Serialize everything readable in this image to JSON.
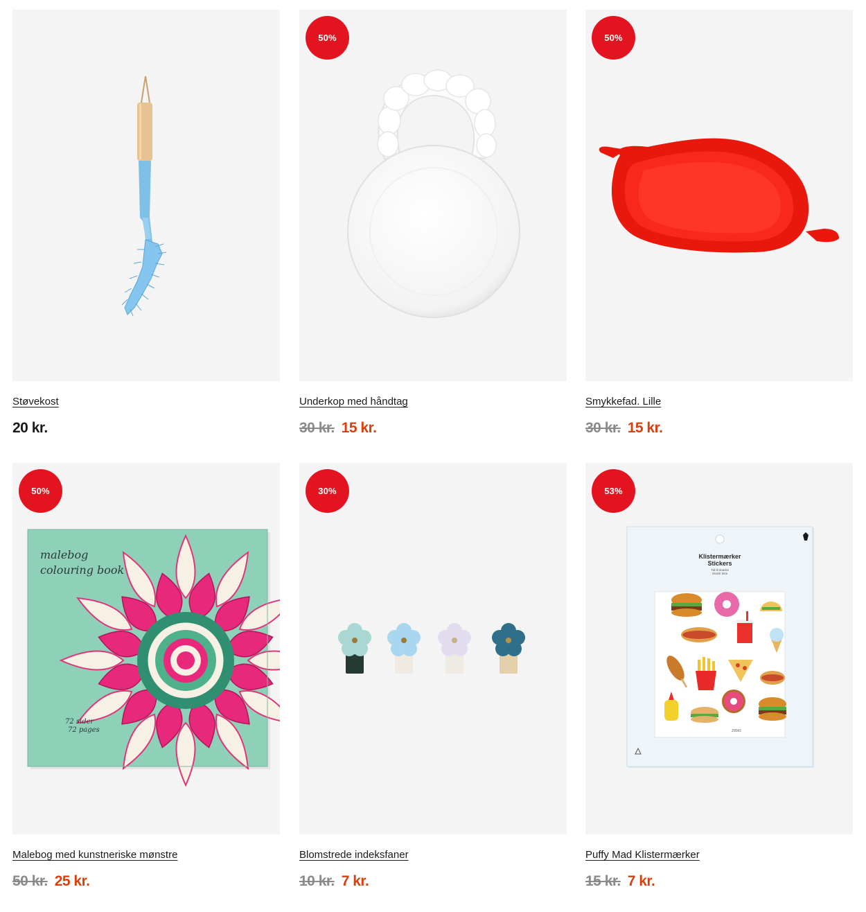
{
  "products": [
    {
      "name": "Støvekost",
      "price": "20 kr.",
      "image": "duster-icon"
    },
    {
      "name": "Underkop med håndtag",
      "badge": "50%",
      "old_price": "30 kr.",
      "price": "15 kr.",
      "image": "saucer-icon"
    },
    {
      "name": "Smykkefad. Lille",
      "badge": "50%",
      "old_price": "30 kr.",
      "price": "15 kr.",
      "image": "heart-tray-icon"
    },
    {
      "name": "Malebog med kunstneriske mønstre",
      "badge": "50%",
      "old_price": "50 kr.",
      "price": "25 kr.",
      "image": "colouring-book-icon",
      "book_title_line1": "malebog",
      "book_title_line2": "colouring book",
      "book_pages_line1": "72 sider",
      "book_pages_line2": "72 pages"
    },
    {
      "name": "Blomstrede indeksfaner",
      "badge": "30%",
      "old_price": "10 kr.",
      "price": "7 kr.",
      "image": "flower-tabs-icon"
    },
    {
      "name": "Puffy Mad Klistermærker",
      "badge": "53%",
      "old_price": "15 kr.",
      "price": "7 kr.",
      "image": "sticker-pack-icon",
      "pack_title_line1": "Klistermærker",
      "pack_title_line2": "Stickers",
      "pack_sub_line1": "Tid til snacks",
      "pack_sub_line2": "Snack time",
      "pack_code": "Z8065"
    }
  ],
  "colors": {
    "badge": "#e3141f",
    "sale_price": "#d8400e",
    "old_price": "#8a8a8a",
    "tile_bg": "#f4f4f4"
  }
}
